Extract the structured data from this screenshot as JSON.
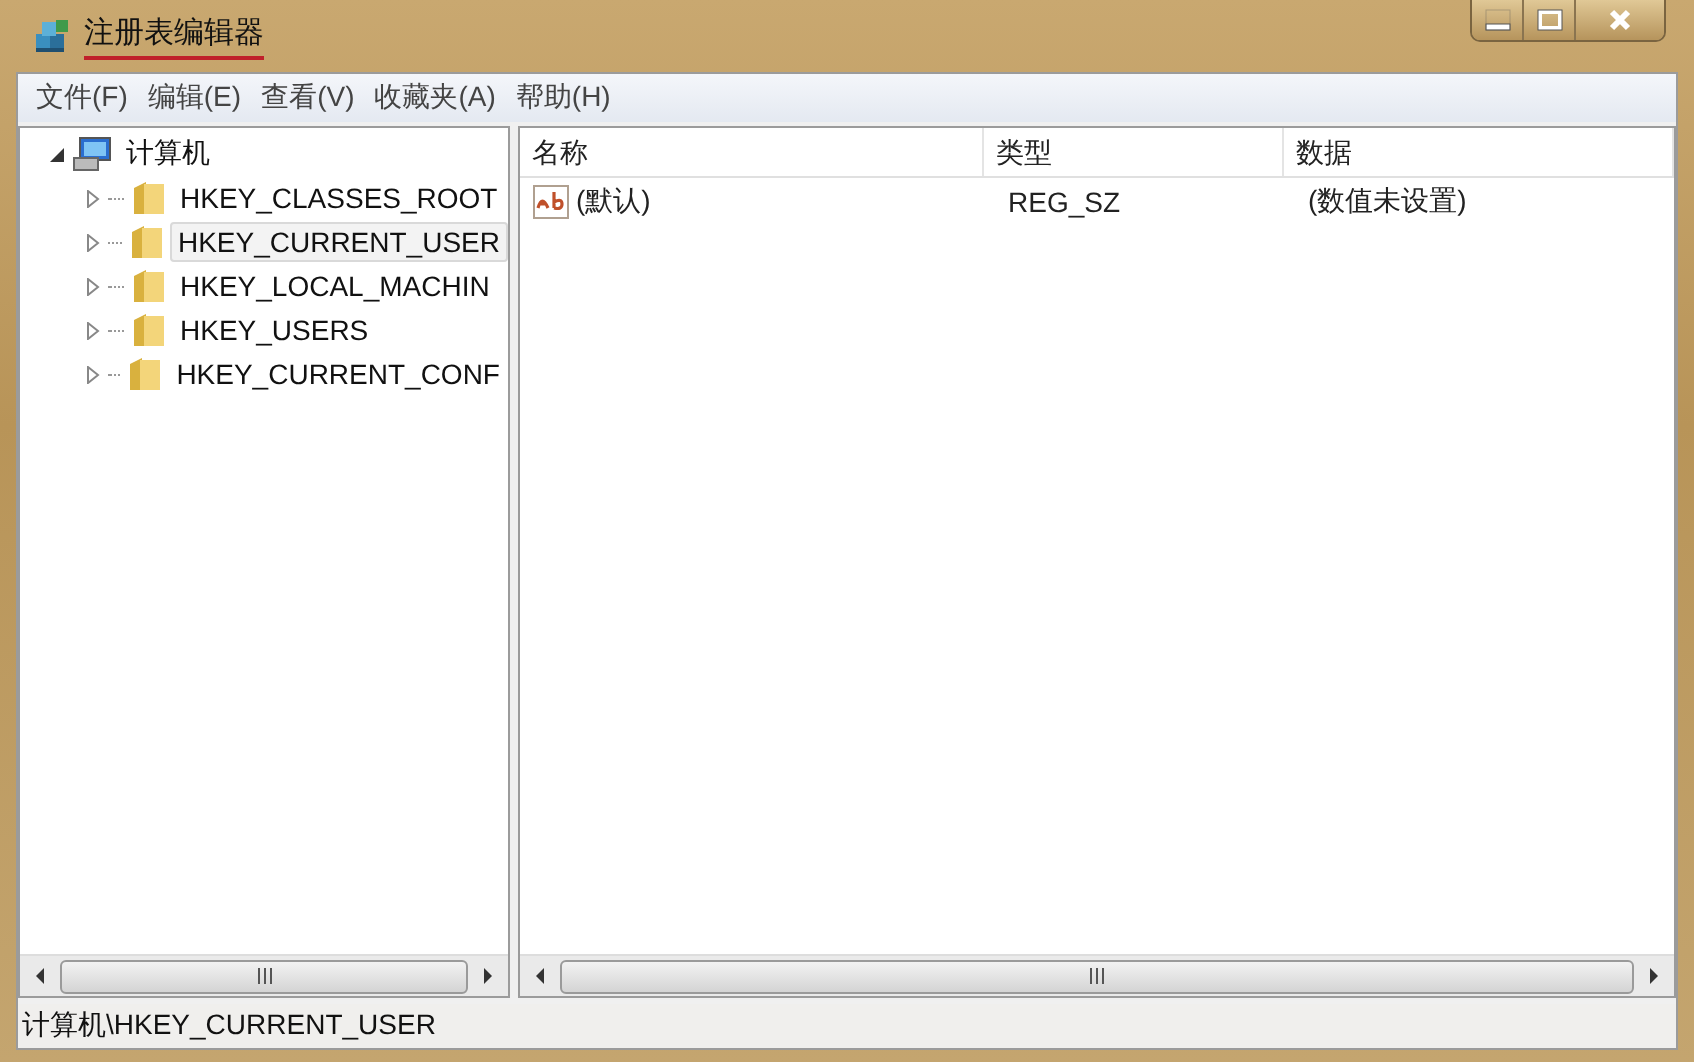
{
  "window": {
    "title": "注册表编辑器"
  },
  "menu": [
    "文件(F)",
    "编辑(E)",
    "查看(V)",
    "收藏夹(A)",
    "帮助(H)"
  ],
  "tree": {
    "label": "计算机",
    "expanded": true,
    "children": [
      {
        "label": "HKEY_CLASSES_ROOT",
        "selected": false,
        "expanded": false
      },
      {
        "label": "HKEY_CURRENT_USER",
        "selected": true,
        "expanded": false
      },
      {
        "label": "HKEY_LOCAL_MACHIN",
        "selected": false,
        "expanded": false
      },
      {
        "label": "HKEY_USERS",
        "selected": false,
        "expanded": false
      },
      {
        "label": "HKEY_CURRENT_CONF",
        "selected": false,
        "expanded": false
      }
    ]
  },
  "table": {
    "columns": [
      "名称",
      "类型",
      "数据"
    ],
    "rows": [
      {
        "name": "(默认)",
        "type": "REG_SZ",
        "data": "(数值未设置)"
      }
    ]
  },
  "status_bar": "计算机\\HKEY_CURRENT_USER"
}
